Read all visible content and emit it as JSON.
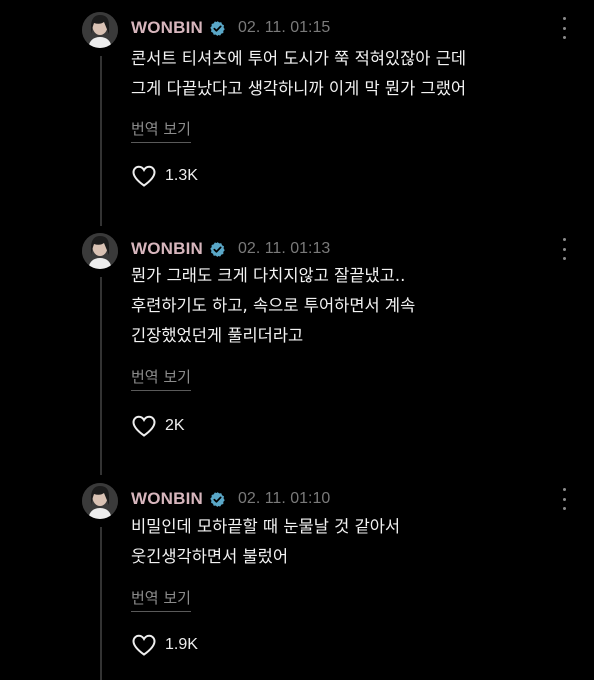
{
  "colors": {
    "background": "#000000",
    "username": "#d7b6bd",
    "verified_badge": "#5aa7c7",
    "timestamp": "#7a7a7a",
    "body_text": "#f3f3f3",
    "secondary_text": "#8c8c8c"
  },
  "posts": [
    {
      "username": "WONBIN",
      "verified": true,
      "timestamp": "02. 11. 01:15",
      "lines": [
        "콘서트 티셔츠에 투어 도시가 쭉 적혀있잖아 근데",
        "그게 다끝났다고 생각하니까 이게 막 뭔가 그랬어"
      ],
      "translate_label": "번역 보기",
      "likes": "1.3K",
      "icons": {
        "more": "more-vertical-icon",
        "like": "heart-icon",
        "badge": "verified-badge-icon"
      }
    },
    {
      "username": "WONBIN",
      "verified": true,
      "timestamp": "02. 11. 01:13",
      "lines": [
        "뭔가 그래도 크게 다치지않고 잘끝냈고..",
        "후련하기도 하고, 속으로 투어하면서 계속",
        "긴장했었던게 풀리더라고"
      ],
      "translate_label": "번역 보기",
      "likes": "2K",
      "icons": {
        "more": "more-vertical-icon",
        "like": "heart-icon",
        "badge": "verified-badge-icon"
      }
    },
    {
      "username": "WONBIN",
      "verified": true,
      "timestamp": "02. 11. 01:10",
      "lines": [
        "비밀인데 모하끝할 때 눈물날 것 같아서",
        "웃긴생각하면서 불렀어"
      ],
      "translate_label": "번역 보기",
      "likes": "1.9K",
      "icons": {
        "more": "more-vertical-icon",
        "like": "heart-icon",
        "badge": "verified-badge-icon"
      }
    }
  ]
}
